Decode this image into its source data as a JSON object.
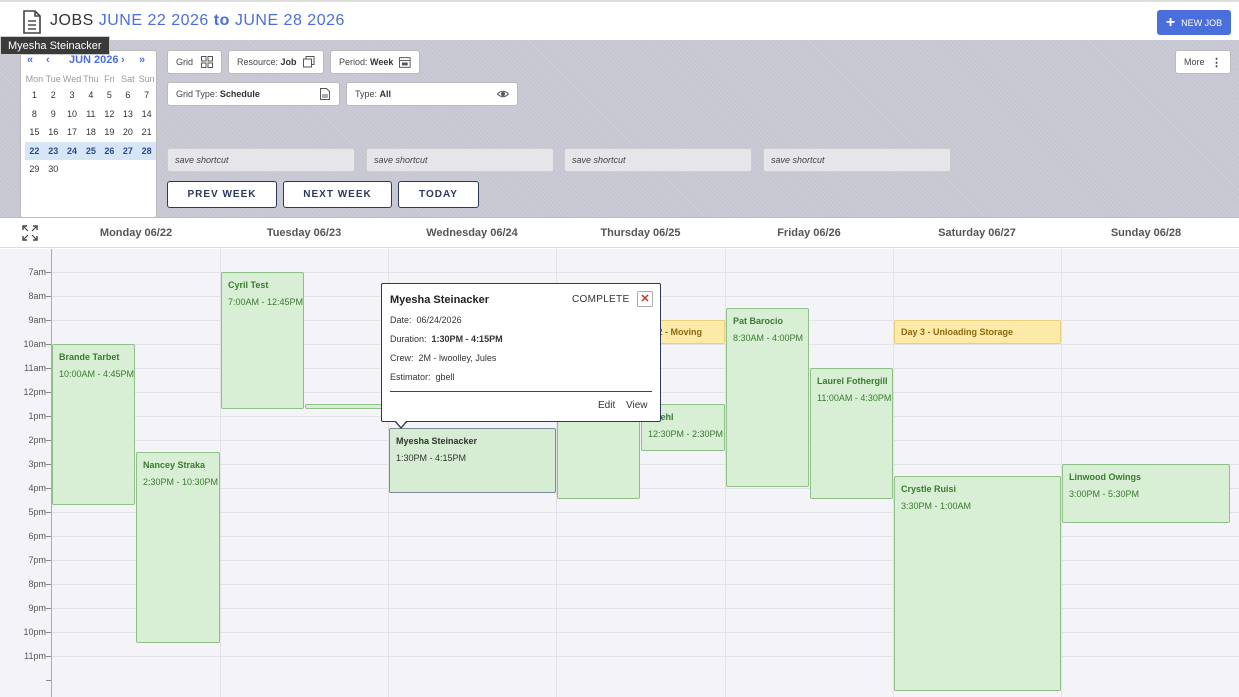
{
  "header": {
    "title_prefix": "JOBS",
    "range_start": "JUNE 22 2026",
    "range_to": "to",
    "range_end": "JUNE 28 2026",
    "new_job_label": "NEW JOB"
  },
  "tooltip": "Myesha Steinacker",
  "mini_calendar": {
    "month": "JUN 2026",
    "weekdays": [
      "Mon",
      "Tue",
      "Wed",
      "Thu",
      "Fri",
      "Sat",
      "Sun"
    ],
    "weeks": [
      [
        "1",
        "2",
        "3",
        "4",
        "5",
        "6",
        "7"
      ],
      [
        "8",
        "9",
        "10",
        "11",
        "12",
        "13",
        "14"
      ],
      [
        "15",
        "16",
        "17",
        "18",
        "19",
        "20",
        "21"
      ],
      [
        "22",
        "23",
        "24",
        "25",
        "26",
        "27",
        "28"
      ],
      [
        "29",
        "30",
        "",
        "",
        "",
        "",
        ""
      ]
    ],
    "current_week_index": 3
  },
  "toolbar": {
    "grid_label": "Grid",
    "resource_label": "Resource:",
    "resource_value": "Job",
    "period_label": "Period:",
    "period_value": "Week",
    "more_label": "More",
    "grid_type_label": "Grid Type:",
    "grid_type_value": "Schedule",
    "type_label": "Type:",
    "type_value": "All",
    "shortcuts": [
      "save shortcut",
      "save shortcut",
      "save shortcut",
      "save shortcut"
    ],
    "prev_week": "PREV WEEK",
    "next_week": "NEXT WEEK",
    "today": "TODAY"
  },
  "days": [
    "Monday 06/22",
    "Tuesday 06/23",
    "Wednesday 06/24",
    "Thursday 06/25",
    "Friday 06/26",
    "Saturday 06/27",
    "Sunday 06/28"
  ],
  "hours": [
    "7am",
    "8am",
    "9am",
    "10am",
    "11am",
    "12pm",
    "1pm",
    "2pm",
    "3pm",
    "4pm",
    "5pm",
    "6pm",
    "7pm",
    "8pm",
    "9pm",
    "10pm",
    "11pm"
  ],
  "events": [
    {
      "name": "Brande Tarbet",
      "time": "10:00AM - 4:45PM"
    },
    {
      "name": "Nancey Straka",
      "time": "2:30PM - 10:30PM"
    },
    {
      "name": "Cyril Test",
      "time": "7:00AM - 12:45PM"
    },
    {
      "name": "Myesha Steinacker",
      "time": "1:30PM - 4:15PM"
    },
    {
      "name": "y 2 - Moving",
      "time": ""
    },
    {
      "name": "a Jehl",
      "time": "12:30PM - 2:30PM"
    },
    {
      "name": "Pat Barocio",
      "time": "8:30AM - 4:00PM"
    },
    {
      "name": "Laurel Fothergill",
      "time": "11:00AM - 4:30PM"
    },
    {
      "name": "Day 3 - Unloading Storage",
      "time": ""
    },
    {
      "name": "Crystle Ruisi",
      "time": "3:30PM - 1:00AM"
    },
    {
      "name": "Linwood Owings",
      "time": "3:00PM - 5:30PM"
    }
  ],
  "popup": {
    "name": "Myesha Steinacker",
    "status": "COMPLETE",
    "date_label": "Date:",
    "date_value": "06/24/2026",
    "duration_label": "Duration:",
    "duration_value": "1:30PM - 4:15PM",
    "crew_label": "Crew:",
    "crew_value": "2M - lwoolley, Jules",
    "estimator_label": "Estimator:",
    "estimator_value": "gbell",
    "edit_label": "Edit",
    "view_label": "View"
  },
  "colors": {
    "accent": "#4a6fdc",
    "event_green": "#d8efd5",
    "event_yellow": "#fde9a8",
    "close_red": "#c0392b"
  }
}
